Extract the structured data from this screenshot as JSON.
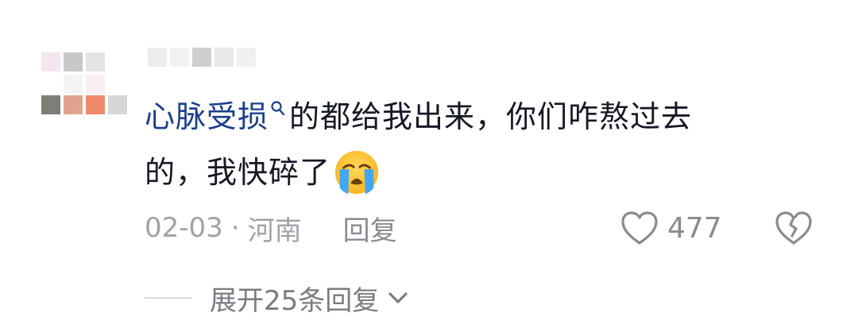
{
  "comment": {
    "keyword": "心脉受损",
    "text_line1": "的都给我出来，你们咋熬过去",
    "text_line2": "的，我快碎了"
  },
  "meta": {
    "date": "02-03",
    "separator": "·",
    "location": "河南",
    "reply_label": "回复"
  },
  "actions": {
    "like_count": "477"
  },
  "expand": {
    "label": "展开25条回复"
  },
  "colors": {
    "keyword": "#1c3f8c",
    "text": "#161823",
    "muted": "#a0a2a8"
  },
  "icons": [
    "search-icon",
    "crying-emoji-icon",
    "heart-icon",
    "broken-heart-icon",
    "chevron-down-icon"
  ]
}
